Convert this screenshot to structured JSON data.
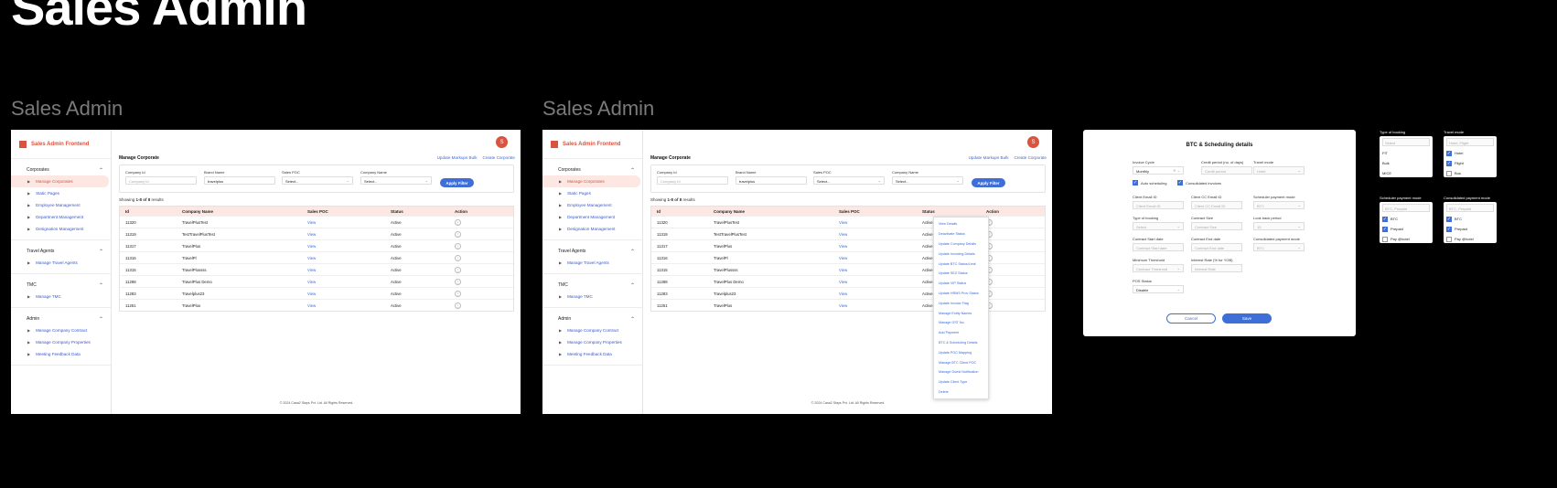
{
  "page_title": "Sales Admin",
  "frame_labels": [
    "Sales Admin",
    "Sales Admin"
  ],
  "colors": {
    "brand": "#d9533e",
    "accent": "#3e6fd8",
    "active_bg": "#fde7e3"
  },
  "sidebar": {
    "logo": "Sales Admin Frontend",
    "groups": [
      {
        "title": "Corporates",
        "items": [
          "Manage Corporates",
          "Static Pages",
          "Employee Management",
          "Department Management",
          "Designation Management"
        ]
      },
      {
        "title": "Travel Agents",
        "items": [
          "Manage Travel Agents"
        ]
      },
      {
        "title": "TMC",
        "items": [
          "Manage TMC"
        ]
      },
      {
        "title": "Admin",
        "items": [
          "Manage Company Contract",
          "Manage Company Properties",
          "Meeting Feedback Data"
        ]
      }
    ]
  },
  "header": {
    "avatar": "S",
    "title": "Manage Corporate",
    "link_bulk": "Update Markups Bulk",
    "link_create": "Create Corporate"
  },
  "filters": {
    "company_id": {
      "label": "Company Id",
      "placeholder": "Company Id"
    },
    "brand_name": {
      "label": "Brand Name",
      "value": "travelplus"
    },
    "sales_poc": {
      "label": "Sales POC",
      "value": "Select..."
    },
    "company_name": {
      "label": "Company Name",
      "value": "Select..."
    },
    "apply": "Apply Filter"
  },
  "showing": {
    "prefix": "Showing ",
    "range": "1-8 of 8",
    "suffix": " results"
  },
  "table": {
    "headers": [
      "Id",
      "Company Name",
      "Sales POC",
      "Status",
      "Action"
    ],
    "rows": [
      [
        "11320",
        "TravelPlusTest",
        "View",
        "Active",
        "⋮"
      ],
      [
        "11319",
        "TestTravelPlusTest",
        "View",
        "Active",
        "⋮"
      ],
      [
        "11317",
        "TravelPlus",
        "View",
        "Active",
        "⋮"
      ],
      [
        "11316",
        "TravelPl",
        "View",
        "Active",
        "⋮"
      ],
      [
        "11315",
        "TravelPlussss",
        "View",
        "Active",
        "⋮"
      ],
      [
        "11288",
        "TravelPlus Demo",
        "View",
        "Active",
        "⋮"
      ],
      [
        "11283",
        "Travelplus23",
        "View",
        "Active",
        "⋮"
      ],
      [
        "11251",
        "TravelPlus",
        "View",
        "Active",
        "⋮"
      ]
    ]
  },
  "footer": "© 2024 Casa2 Stays Pvt. Ltd. All Rights Reserved.",
  "action_menu": [
    "View Details",
    "Deactivate Status",
    "Update Company Details",
    "Update Invoicing Details",
    "Update BTC Status/Limit",
    "Update SEZ Status",
    "Update VIP Status",
    "Update HRMS Prov Status",
    "Update Invoice Flag",
    "Manage Entity Names",
    "Manage GST No.",
    "Add Payment",
    "BTC & Scheduling Details",
    "Update POC Mapping",
    "Manage BTC Client POC",
    "Manage Guest Notification",
    "Update Client Type",
    "Delete"
  ],
  "modal": {
    "title": "BTC & Scheduling details",
    "invoice_cycle": {
      "label": "Invoice Cycle",
      "value": "Monthly"
    },
    "credit_period": {
      "label": "Credit period (no. of days)",
      "placeholder": "Credit period"
    },
    "travel_mode": {
      "label": "Travel mode",
      "value": "Hotel"
    },
    "auto_scheduling": "Auto scheduling",
    "consolidated_invoices": "Consolidated invoices",
    "client_email": {
      "label": "Client Email ID",
      "placeholder": "Client Email ID"
    },
    "client_cc_email": {
      "label": "Client CC Email ID",
      "placeholder": "Client CC Email ID"
    },
    "scheduler_payment_mode": {
      "label": "Scheduler payment mode",
      "value": "BTC"
    },
    "type_of_booking": {
      "label": "Type of booking",
      "value": "Select"
    },
    "contract_size": {
      "label": "Contract Size",
      "placeholder": "Contract Size"
    },
    "look_back_period": {
      "label": "Look back period",
      "value": "15"
    },
    "contract_start": {
      "label": "Contract Start date",
      "placeholder": "Contract Start date"
    },
    "contract_end": {
      "label": "Contract End date",
      "placeholder": "Contract End date"
    },
    "consolidated_payment_mode": {
      "label": "Consolidated payment mode",
      "value": "BTC"
    },
    "minimum_threshold": {
      "label": "Minimum Threshold",
      "placeholder": "Contract Threshold"
    },
    "interest_rate": {
      "label": "Interest Rate (% for YOB)",
      "placeholder": "Interest Rate"
    },
    "pos_status": {
      "label": "POS Status",
      "value": "Disable"
    },
    "cancel": "Cancel",
    "save": "Save"
  },
  "side_panels": {
    "type_of_booking": {
      "label": "Type of booking",
      "select": "Select",
      "options": [
        "FIT",
        "Bulk",
        "MICE"
      ]
    },
    "travel_mode": {
      "label": "Travel mode",
      "select": "Hotel, Flight",
      "options": [
        {
          "text": "Hotel",
          "checked": true
        },
        {
          "text": "Flight",
          "checked": true
        },
        {
          "text": "Bus",
          "checked": false
        }
      ]
    },
    "scheduler_payment_mode": {
      "label": "Scheduler payment mode",
      "select": "BTC, Prepaid",
      "options": [
        {
          "text": "BTC",
          "checked": true
        },
        {
          "text": "Prepaid",
          "checked": true
        },
        {
          "text": "Pay @hotel",
          "checked": false
        }
      ]
    },
    "consolidated_payment_mode": {
      "label": "Consolidated payment mode",
      "select": "BTC, Prepaid",
      "options": [
        {
          "text": "BTC",
          "checked": true
        },
        {
          "text": "Prepaid",
          "checked": true
        },
        {
          "text": "Pay @hotel",
          "checked": false
        }
      ]
    }
  }
}
